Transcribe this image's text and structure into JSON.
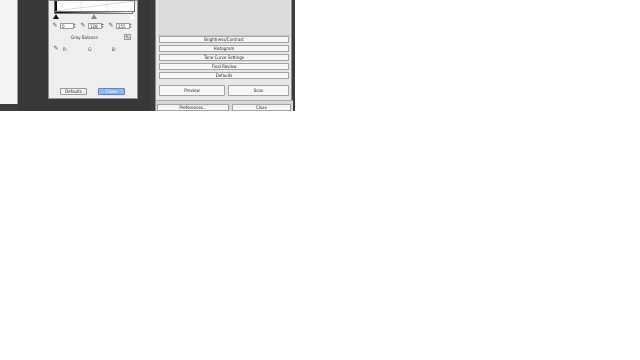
{
  "levels_dialog": {
    "black_point": "0",
    "gray_point": "128",
    "white_point": "255",
    "gray_balance_label": "Gray Balance",
    "r_label": "R:",
    "g_label": "G:",
    "b_label": "B:",
    "defaults_label": "Defaults",
    "close_label": "Close"
  },
  "scan_panel": {
    "menu_items": [
      "Brightness/Contrast",
      "Histogram",
      "Tone Curve Settings",
      "Final Review",
      "Defaults"
    ],
    "preview_label": "Preview",
    "scan_label": "Scan",
    "preferences_label": "Preferences...",
    "close_label": "Close"
  },
  "icons": {
    "eyedropper": "eyedropper-icon",
    "spinner": "spinner-arrows-icon"
  },
  "colors": {
    "accent_button": "#8fb9ea",
    "dark_background": "#3c3c3c"
  }
}
